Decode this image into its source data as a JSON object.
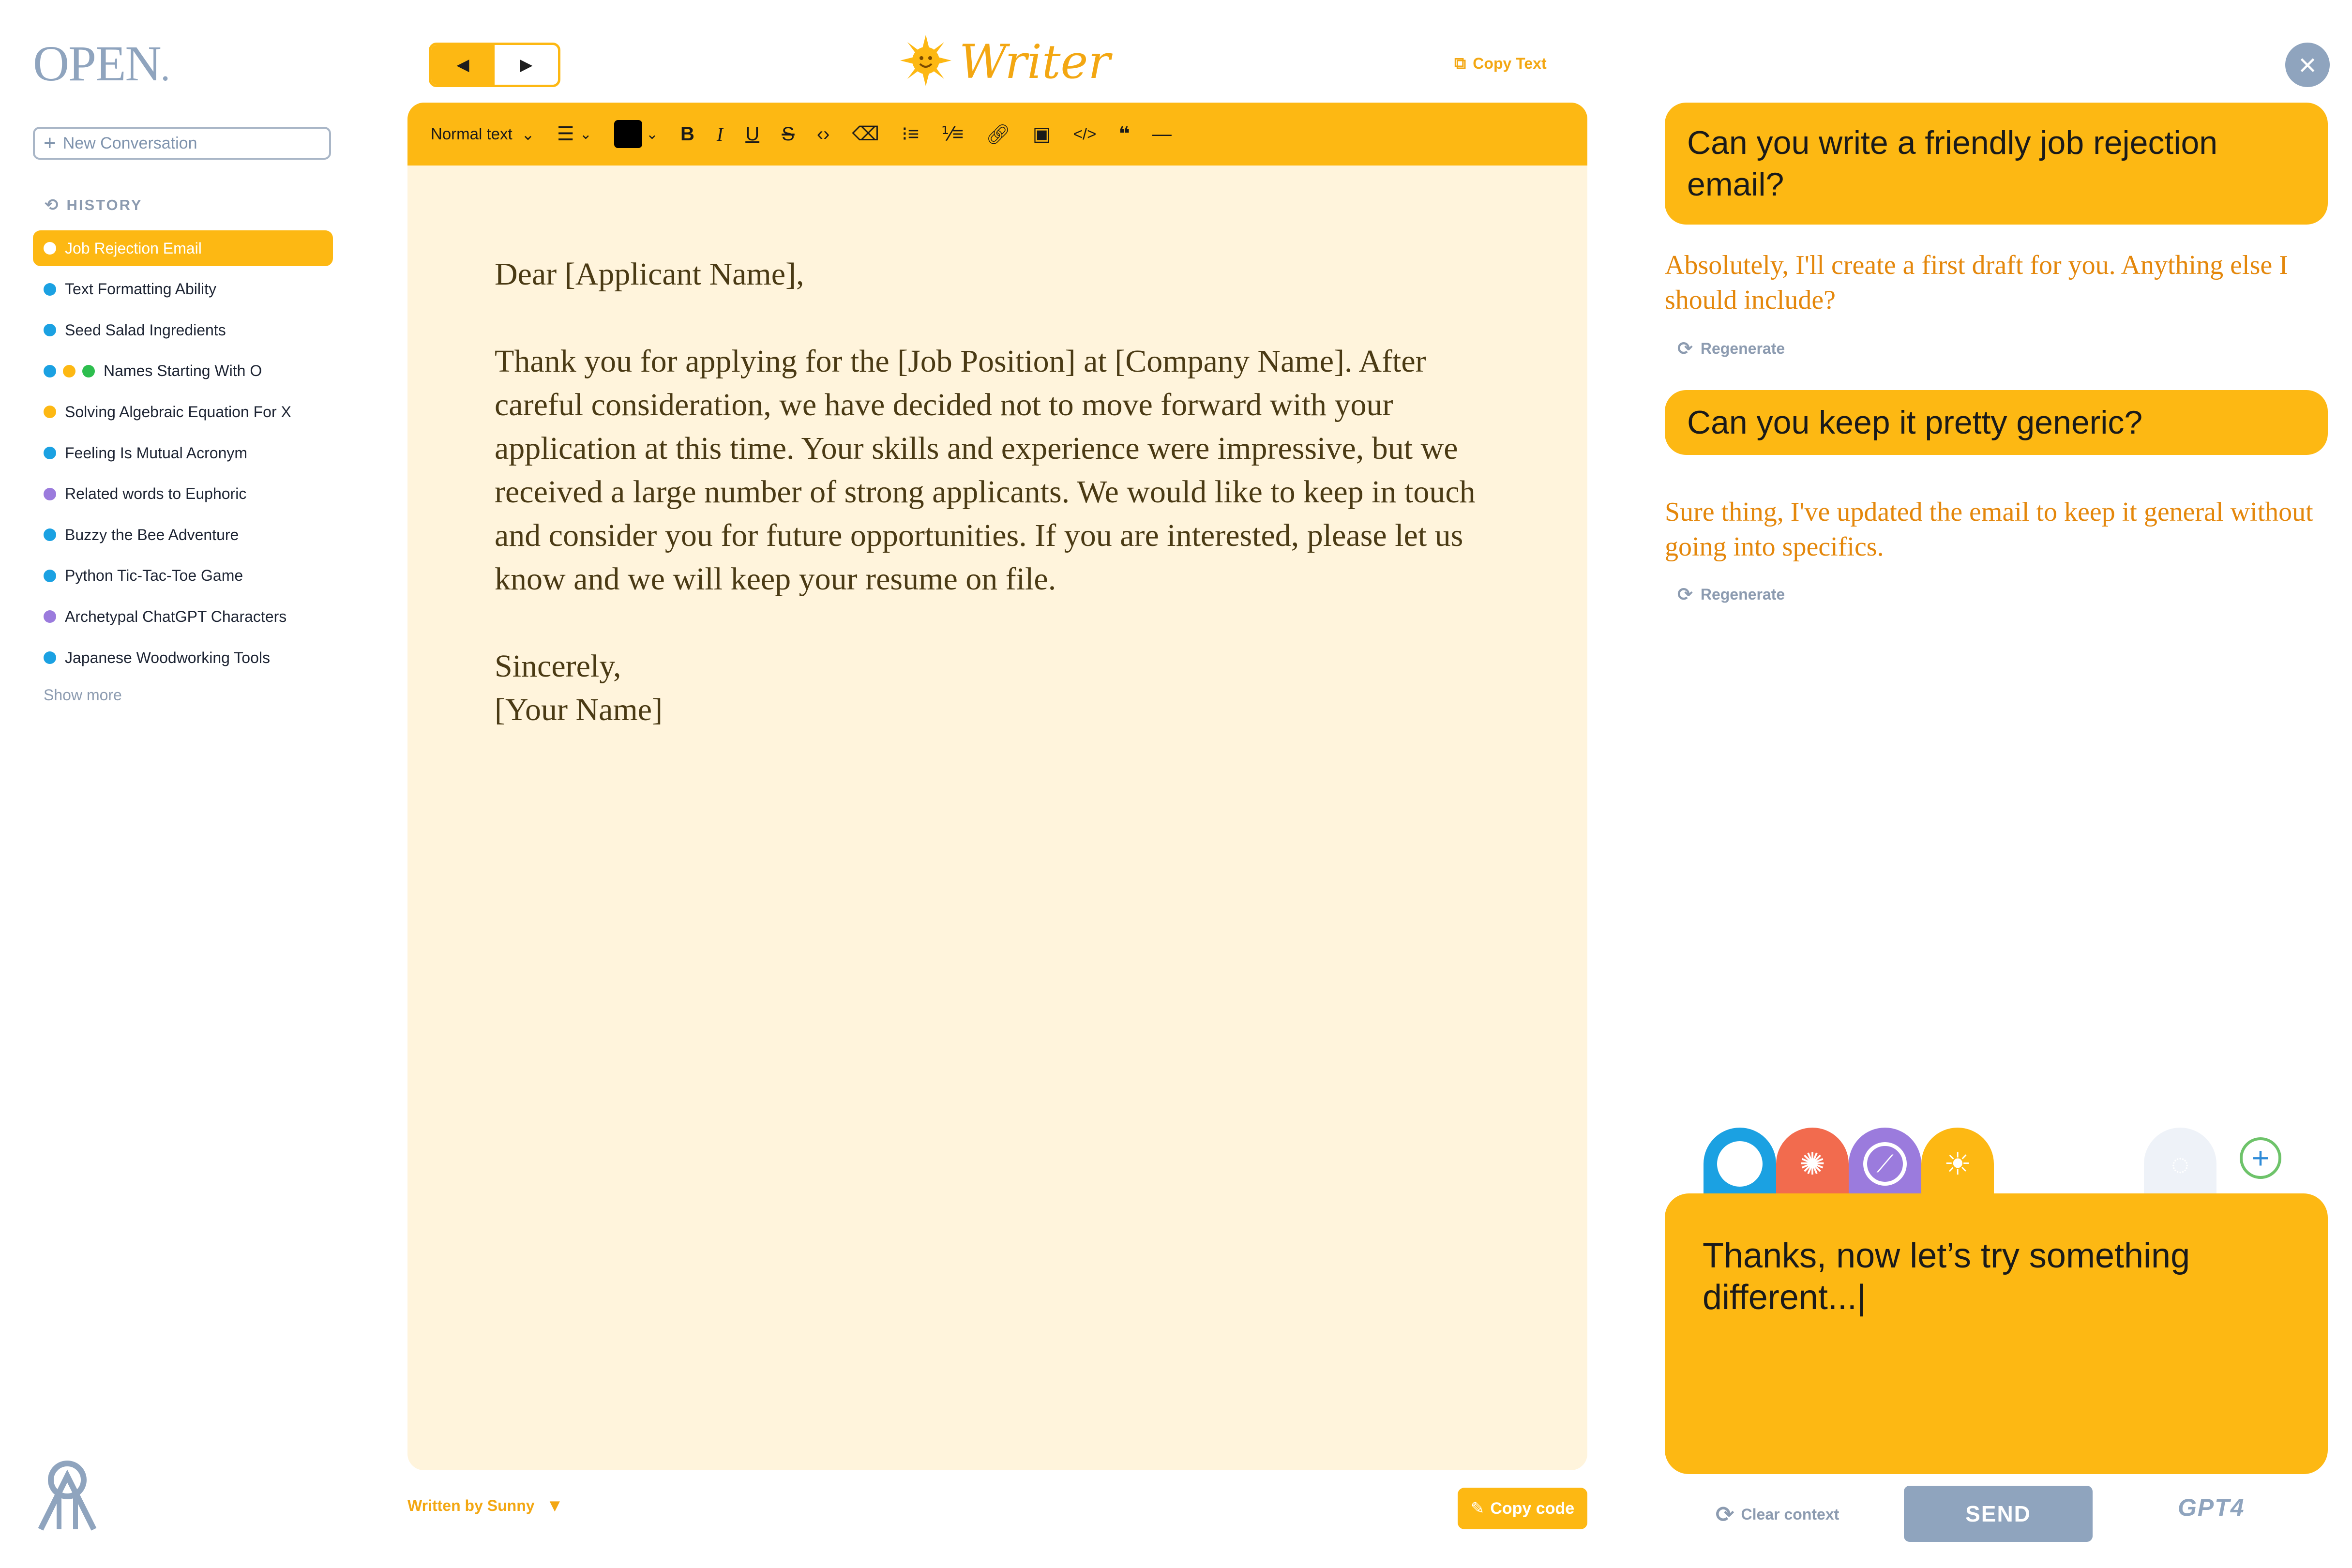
{
  "sidebar": {
    "logo_text": "OPEN",
    "logo_mark": ".",
    "new_conversation_label": "New Conversation",
    "history_label": "HISTORY",
    "items": [
      {
        "label": "Job Rejection Email",
        "dots": [
          "#FFFFFF"
        ],
        "active": true
      },
      {
        "label": "Text Formatting Ability",
        "dots": [
          "#1BA1E2"
        ]
      },
      {
        "label": "Seed Salad Ingredients",
        "dots": [
          "#1BA1E2"
        ]
      },
      {
        "label": "Names Starting With O",
        "dots": [
          "#1BA1E2",
          "#FDB813",
          "#2DBE4E"
        ]
      },
      {
        "label": "Solving Algebraic Equation For X",
        "dots": [
          "#FDB813"
        ]
      },
      {
        "label": "Feeling Is Mutual Acronym",
        "dots": [
          "#1BA1E2"
        ]
      },
      {
        "label": "Related words to Euphoric",
        "dots": [
          "#9B7BDD"
        ]
      },
      {
        "label": "Buzzy the Bee Adventure",
        "dots": [
          "#1BA1E2"
        ]
      },
      {
        "label": "Python Tic-Tac-Toe Game",
        "dots": [
          "#1BA1E2"
        ]
      },
      {
        "label": "Archetypal ChatGPT Characters",
        "dots": [
          "#9B7BDD"
        ]
      },
      {
        "label": "Japanese Woodworking Tools",
        "dots": [
          "#1BA1E2"
        ]
      }
    ],
    "show_more_label": "Show more"
  },
  "header": {
    "back_icon": "◀",
    "forward_icon": "▶",
    "app_title": "Writer",
    "copy_text_label": "Copy Text"
  },
  "toolbar": {
    "text_style": "Normal text",
    "text_color": "#000000",
    "tools": [
      "align",
      "color",
      "bold",
      "italic",
      "underline",
      "strikethrough",
      "inline-code",
      "clear-format",
      "bullet-list",
      "numbered-list",
      "link",
      "image",
      "code-block",
      "quote",
      "horizontal-rule"
    ]
  },
  "document": {
    "greeting": "Dear [Applicant Name],",
    "body": "Thank you for applying for the [Job Position] at [Company Name]. After careful consideration, we have decided not to move forward with your application at this time. Your skills and experience were impressive, but we received a large number of strong applicants. We would like to keep in touch and consider you for future opportunities. If you are interested, please let us know and we will keep your resume on file.",
    "closing": "Sincerely,",
    "signature": "[Your Name]"
  },
  "footer": {
    "written_by": "Written by Sunny",
    "copy_code_label": "Copy code"
  },
  "chat": {
    "messages": [
      {
        "role": "user",
        "text": "Can you write a friendly job rejection email?"
      },
      {
        "role": "assistant",
        "text": "Absolutely, I'll create a first draft for you. Anything else I should include?"
      },
      {
        "role": "user",
        "text": "Can you keep it pretty generic?"
      },
      {
        "role": "assistant",
        "text": "Sure thing, I've updated the email to keep it general without going into specifics."
      }
    ],
    "regenerate_label": "Regenerate",
    "personas": [
      {
        "name": "blue-persona",
        "color": "#1BA1E2"
      },
      {
        "name": "red-persona",
        "color": "#F26B4E"
      },
      {
        "name": "purple-persona",
        "color": "#9B7BDD"
      },
      {
        "name": "sunny-persona",
        "color": "#FDB813"
      },
      {
        "name": "faded-persona",
        "color": "#EEF2F8"
      }
    ],
    "composer_text": "Thanks, now let’s try something different...|",
    "clear_context_label": "Clear context",
    "send_label": "SEND",
    "model_badge": "GPT4"
  }
}
